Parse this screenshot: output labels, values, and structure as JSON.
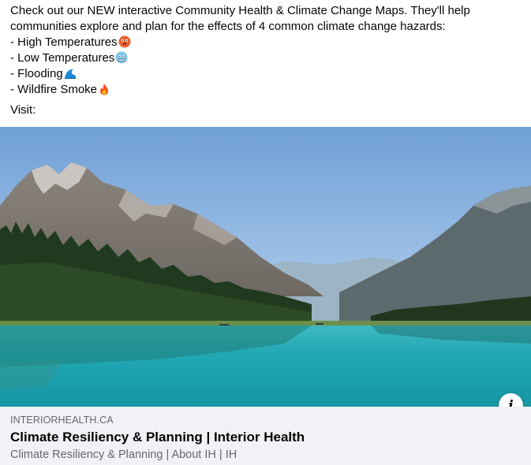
{
  "post": {
    "intro_line1": "Check out our NEW interactive Community Health & Climate Change Maps. They'll help",
    "intro_line2": "communities explore and plan for the effects of 4 common climate change hazards:",
    "hazards": [
      {
        "label": "- High Temperatures",
        "icon": "hot-face-emoji-icon"
      },
      {
        "label": "- Low Temperatures",
        "icon": "cold-face-emoji-icon"
      },
      {
        "label": "- Flooding",
        "icon": "water-wave-emoji-icon"
      },
      {
        "label": "- Wildfire Smoke",
        "icon": "fire-emoji-icon"
      }
    ],
    "visit": "Visit:"
  },
  "link_preview": {
    "image_icon": "mountain-lake-photo",
    "info_icon": "info-icon",
    "info_glyph": "i",
    "domain": "INTERIORHEALTH.CA",
    "title": "Climate Resiliency & Planning | Interior Health",
    "description": "Climate Resiliency & Planning | About IH | IH"
  },
  "colors": {
    "card_background": "#f0f2f5",
    "secondary_text": "#65676b",
    "primary_text": "#050505",
    "lake_turquoise": "#1fa5b3",
    "sky_blue": "#8fb6e0"
  }
}
